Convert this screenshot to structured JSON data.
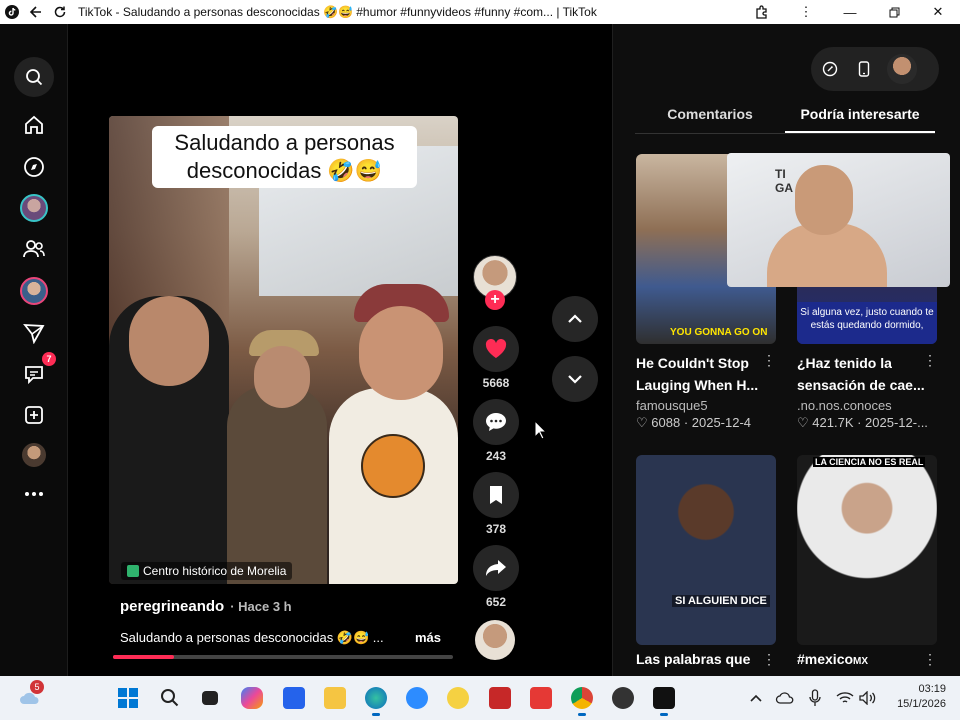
{
  "window": {
    "title": "TikTok - Saludando a personas desconocidas 🤣😅 #humor #funnyvideos #funny #com... | TikTok"
  },
  "video": {
    "overlay_caption": "Saludando a personas desconocidas 🤣😅",
    "location": "Centro histórico de Morelia",
    "author": "peregrineando",
    "posted": "· Hace 3 h",
    "description": "Saludando a personas desconocidas 🤣😅 ...",
    "more_label": "más",
    "progress_fraction": 0.18
  },
  "actions": {
    "likes": "5668",
    "comments": "243",
    "saves": "378",
    "shares": "652"
  },
  "sidebar": {
    "notifications_badge": "7"
  },
  "right_panel": {
    "tabs": [
      "Comentarios",
      "Podría interesarte"
    ],
    "active_tab": "Podría interesarte",
    "cards": [
      {
        "title": "He Couldn't Stop Lauging When H...",
        "author": "famousque5",
        "likes": "6088",
        "date": "2025-12-4",
        "thumb_caption": "YOU GONNA GO ON"
      },
      {
        "title": "¿Haz tenido la sensación de cae...",
        "author": ".no.nos.conoces",
        "likes": "421.7K",
        "date": "2025-12-...",
        "thumb_caption": "Si alguna vez, justo cuando te estás quedando dormido,"
      },
      {
        "title": "Las palabras que",
        "thumb_caption": "SI ALGUIEN DICE"
      },
      {
        "title": "#mexico",
        "title_suffix": "MX",
        "thumb_caption": "LA CIENCIA NO ES REAL"
      }
    ]
  },
  "webcam": {
    "sign_text": "TI\nGA"
  },
  "taskbar": {
    "weather_badge": "5",
    "time": "03:19",
    "date": "15/1/2026"
  },
  "colors": {
    "accent": "#fe2c55",
    "background": "#000000",
    "panel": "#0e0e0e"
  }
}
